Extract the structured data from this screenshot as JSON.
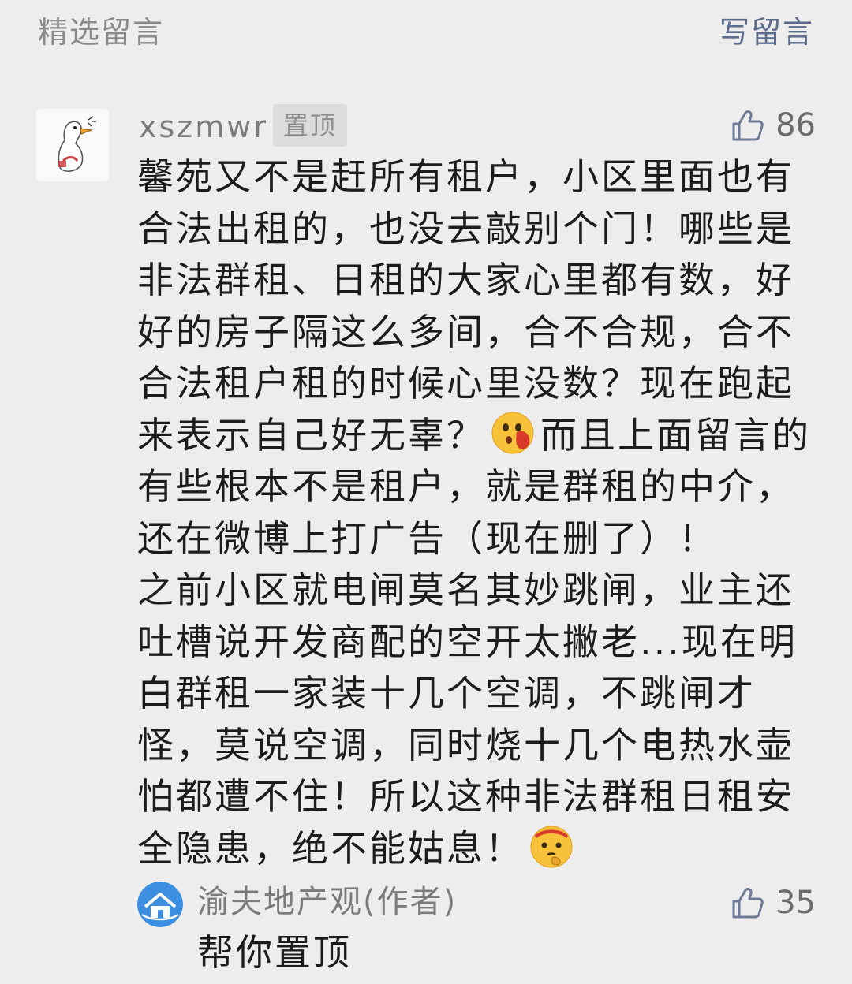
{
  "header": {
    "section_title": "精选留言",
    "write_label": "写留言"
  },
  "comment": {
    "username": "xszmwr",
    "pin_badge": "置顶",
    "likes": "86",
    "lines": {
      "l1": "馨苑又不是赶所有租户，小区里面也有",
      "l2": "合法出租的，也没去敲别个门！哪些是",
      "l3": "非法群租、日租的大家心里都有数，好",
      "l4": "好的房子隔这么多间，合不合规，合不",
      "l5": "合法租户租的时候心里没数？现在跑起",
      "l6a": "来表示自己好无辜？",
      "l6b": "而且上面留言的",
      "l7": "有些根本不是租户，就是群租的中介，",
      "l8": "还在微博上打广告（现在删了）！",
      "l9": "之前小区就电闸莫名其妙跳闸，业主还",
      "l10": "吐槽说开发商配的空开太撇老...现在明",
      "l11": "白群租一家装十几个空调，不跳闸才",
      "l12": "怪，莫说空调，同时烧十几个电热水壶",
      "l13": "怕都遭不住！所以这种非法群租日租安",
      "l14": "全隐患，绝不能姑息！"
    },
    "emojis": [
      "shocked-face-emoji",
      "thinking-face-emoji"
    ]
  },
  "reply": {
    "author": "渝夫地产观(作者)",
    "text": "帮你置顶",
    "likes": "35"
  },
  "colors": {
    "background": "#ededed",
    "link": "#5a6b8c",
    "secondary_text": "#7b7b7b",
    "badge_bg": "#dcdcdc",
    "reply_avatar": "#3c8ee0"
  }
}
